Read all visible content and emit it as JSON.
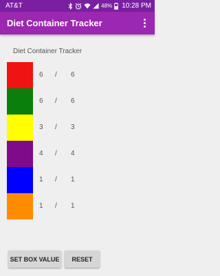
{
  "status_bar": {
    "carrier": "AT&T",
    "battery": "48%",
    "time": "10:28 PM"
  },
  "app_bar": {
    "title": "Diet Container Tracker"
  },
  "main": {
    "heading": "Diet Container Tracker",
    "separator": "/",
    "rows": [
      {
        "color": "#ef1313",
        "current": "6",
        "max": "6"
      },
      {
        "color": "#0b7f0b",
        "current": "6",
        "max": "6"
      },
      {
        "color": "#ffff00",
        "current": "3",
        "max": "3"
      },
      {
        "color": "#7f0a8a",
        "current": "4",
        "max": "4"
      },
      {
        "color": "#0000ff",
        "current": "1",
        "max": "1"
      },
      {
        "color": "#ff8c00",
        "current": "1",
        "max": "1"
      }
    ]
  },
  "buttons": {
    "set_box_value": "SET BOX VALUE",
    "reset": "RESET"
  },
  "colors": {
    "status_bar": "#7b1fa2",
    "app_bar": "#9c27b0",
    "background": "#efefef"
  }
}
